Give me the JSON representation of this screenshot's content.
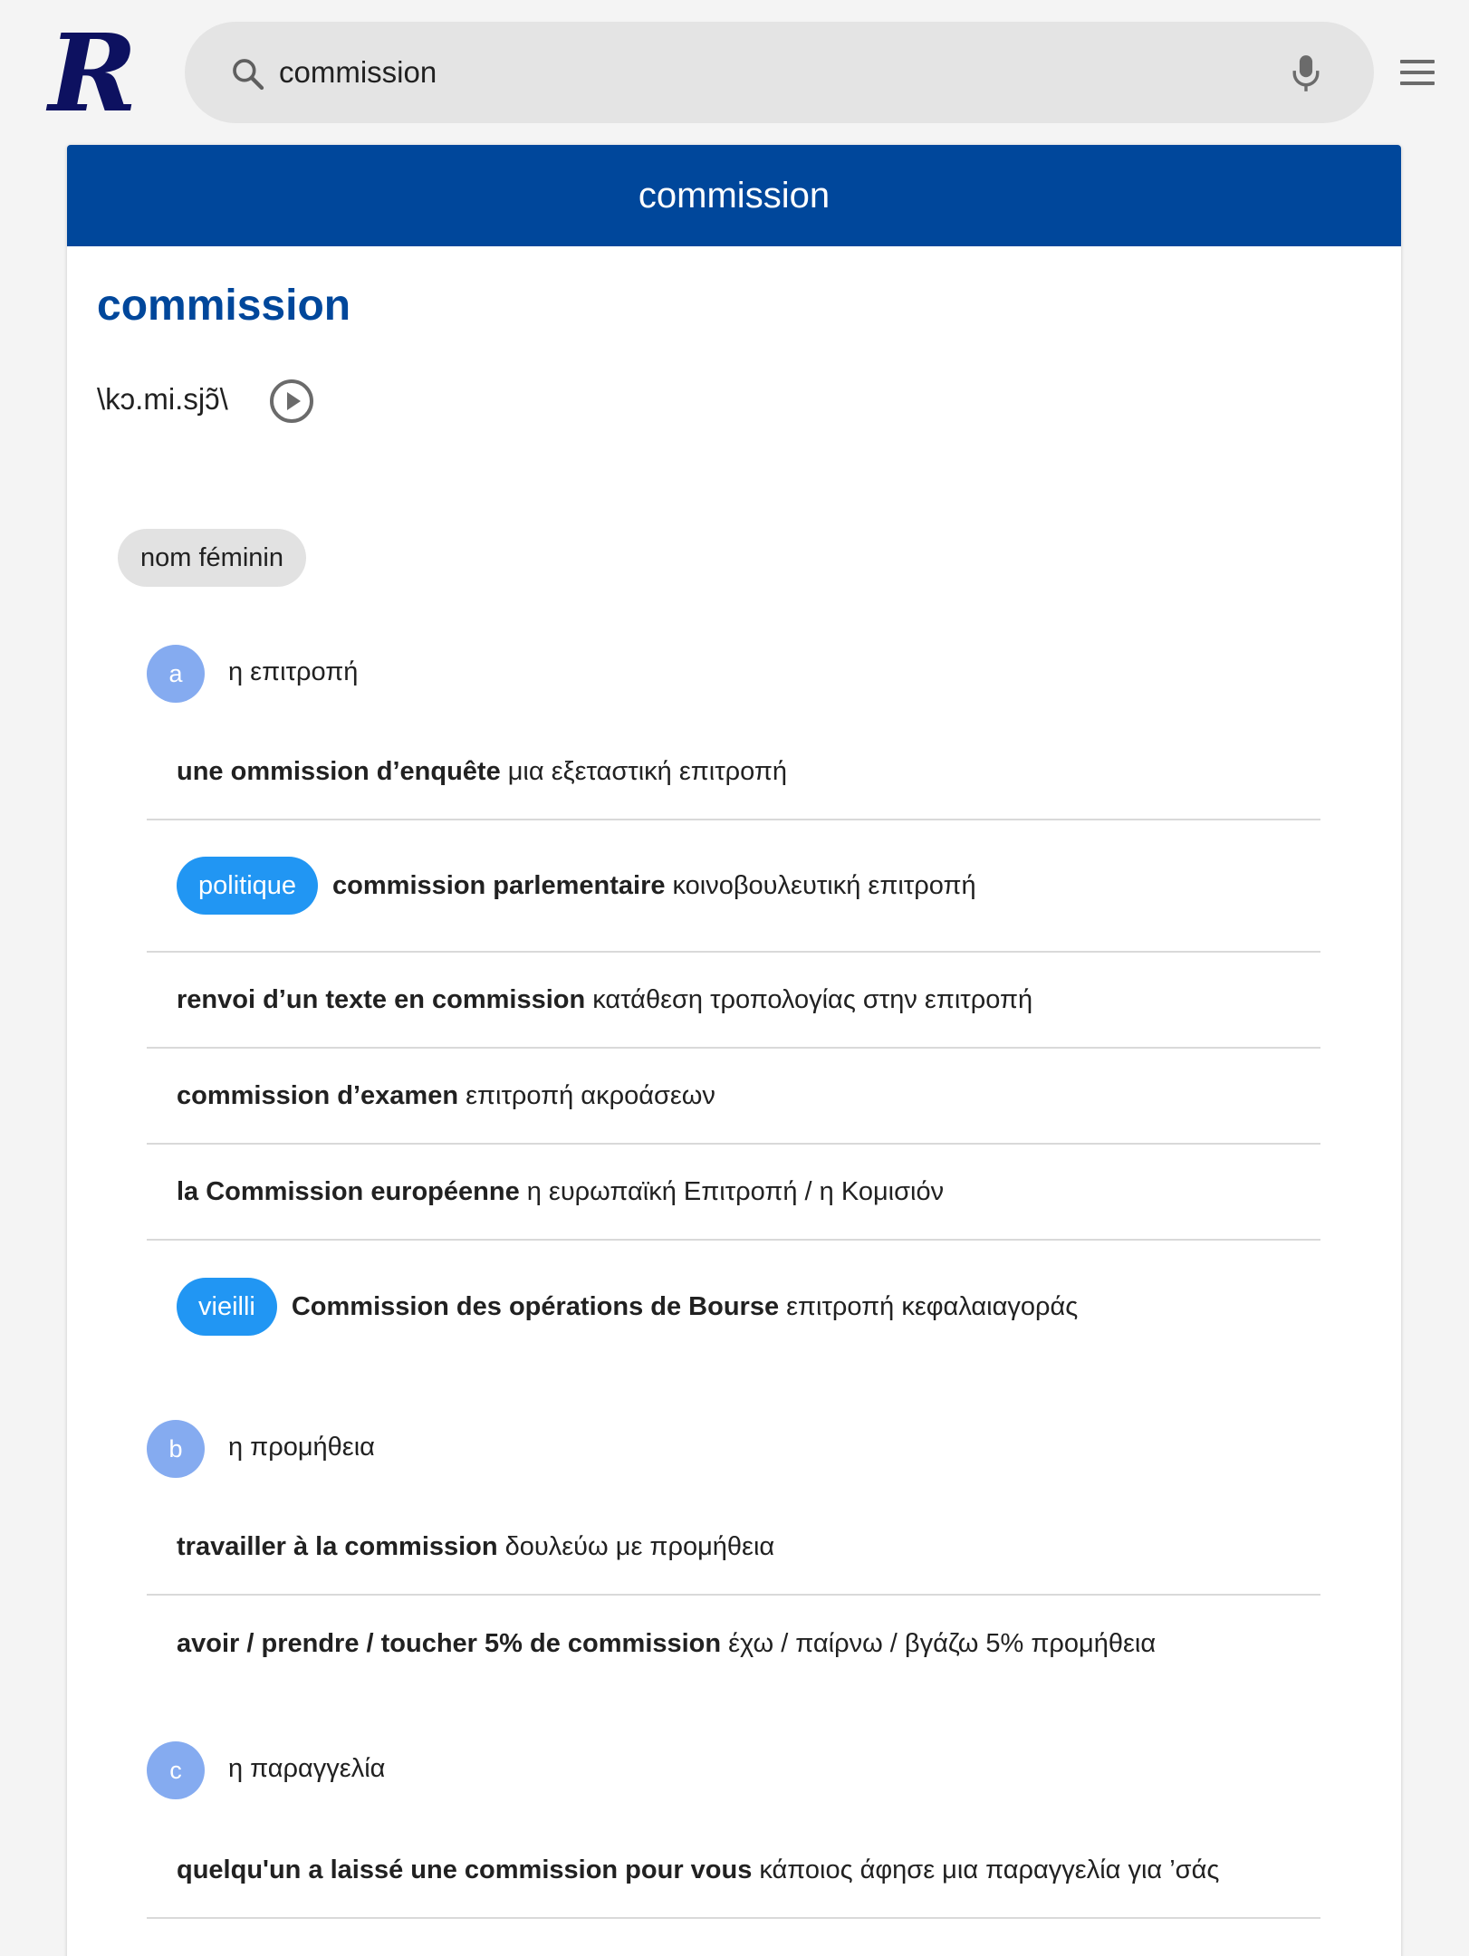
{
  "logo": {
    "letter": "R"
  },
  "search": {
    "value": "commission"
  },
  "card": {
    "header_title": "commission",
    "headword": "commission",
    "pronunciation": "\\kɔ.mi.sjɔ̃\\",
    "pos": "nom féminin"
  },
  "senses": [
    {
      "badge": "a",
      "label": "η επιτροπή",
      "examples": [
        {
          "tag": "",
          "fr": "une ommission d’enquête",
          "gr": "μια εξεταστική επιτροπή"
        },
        {
          "tag": "politique",
          "fr": "commission parlementaire",
          "gr": "κοινοβουλευτική επιτροπή"
        },
        {
          "tag": "",
          "fr": "renvoi d’un texte en commission",
          "gr": "κατάθεση τροπολογίας στην επιτροπή"
        },
        {
          "tag": "",
          "fr": "commission d’examen",
          "gr": "επιτροπή ακροάσεων"
        },
        {
          "tag": "",
          "fr": "la Commission européenne",
          "gr": "η ευρωπαϊκή Επιτροπή / η Κομισιόν"
        },
        {
          "tag": "vieilli",
          "fr": "Commission des opérations de Bourse",
          "gr": "επιτροπή κεφαλαιαγοράς"
        }
      ]
    },
    {
      "badge": "b",
      "label": "η προμήθεια",
      "examples": [
        {
          "tag": "",
          "fr": "travailler à la commission",
          "gr": "δουλεύω με προμήθεια"
        },
        {
          "tag": "",
          "fr": "avoir / prendre / toucher 5% de commission",
          "gr": "έχω / παίρνω / βγάζω 5% προμήθεια"
        }
      ]
    },
    {
      "badge": "c",
      "label": "η παραγγελία",
      "examples": [
        {
          "tag": "",
          "fr": "quelqu'un a laissé une commission pour vous",
          "gr": "κάποιος άφησε μια παραγγελία για ’σάς"
        }
      ]
    }
  ],
  "colors": {
    "brand": "#00479b",
    "tag": "#2196f3",
    "badge": "#85abf0",
    "logo": "#0d1160"
  },
  "icons": {
    "search": "search-icon",
    "mic": "mic-icon",
    "menu": "hamburger-menu-icon",
    "play": "play-circle-icon"
  }
}
